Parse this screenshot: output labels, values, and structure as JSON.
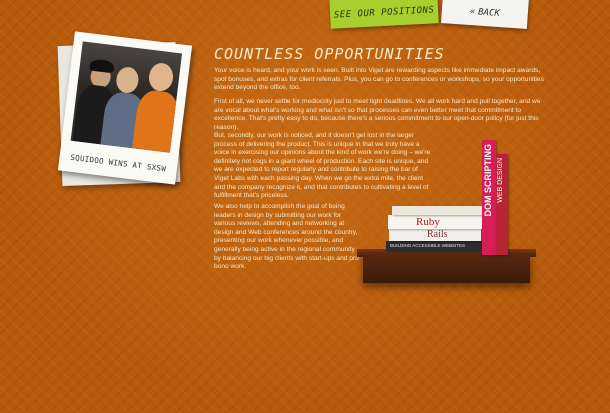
{
  "nav": {
    "positions_label": "SEE OUR POSITIONS",
    "back_label": "BACK",
    "back_icon": "double-chevron-left"
  },
  "photo": {
    "caption": "SQUIDOO WINS AT SXSW"
  },
  "main": {
    "heading": "COUNTLESS OPPORTUNITIES",
    "paragraphs": [
      "Your voice is heard, and your work is seen. Built into Viget are rewarding aspects like immediate impact awards, spot bonuses, and extras for client referrals. Plus, you can go to conferences or workshops, so your opportunities extend beyond the office, too.",
      "First of all, we never settle for mediocrity just to meet tight deadlines. We all work hard and pull together, and we are vocal about what's working and what isn't so that processes can even better meet that commitment to excellence. That's pretty easy to do, because there's a serious commitment to our open-door policy (for just this reason).",
      "But, secondly, our work is noticed, and it doesn't get lost in the larger process of delivering the product. This is unique in that we truly have a voice in exercising our opinions about the kind of work we're doing – we're definitely not cogs in a giant wheel of production. Each site is unique, and we are expected to report regularly and contribute to raising the bar of Viget Labs with each passing day. When we go the extra mile, the client and the company recognize it, and that contributes to cultivating a level of fulfillment that's priceless.",
      "We also help to accomplish the goal of being leaders in design by submitting our work for various reviews, attending and networking at design and Web conferences around the country, presenting our work whenever possible, and generally being active in the regional community by balancing our big clients with start-ups and pro bono work."
    ]
  },
  "books": {
    "dom": "DOM SCRIPTING",
    "web": "WEB DESIGN",
    "ruby": "Ruby",
    "rails": "Rails",
    "accessible": "BUILDING ACCESSIBLE WEBSITES"
  },
  "colors": {
    "background": "#b65a0c",
    "text": "#fbe6c4",
    "tab_green": "#a7cf2e",
    "tab_white": "#f4f4f0"
  }
}
